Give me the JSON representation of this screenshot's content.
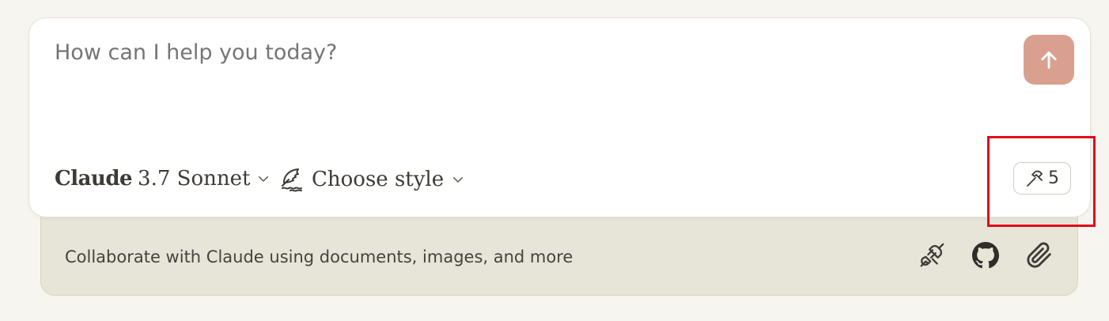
{
  "composer": {
    "prompt_placeholder": "How can I help you today?",
    "send_icon": "arrow-up-icon",
    "model": {
      "brand": "Claude",
      "version": "3.7 Sonnet"
    },
    "style_label": "Choose style",
    "style_icon": "quill-icon",
    "tools": {
      "icon": "hammer-icon",
      "count": "5"
    }
  },
  "drawer": {
    "text": "Collaborate with Claude using documents, images, and more",
    "icons": [
      "plug-icon",
      "github-icon",
      "paperclip-icon"
    ]
  },
  "colors": {
    "page_bg": "#f7f5ef",
    "send_button": "#d9a090",
    "drawer_bg": "#e7e4d8",
    "highlight": "#e0091a"
  }
}
